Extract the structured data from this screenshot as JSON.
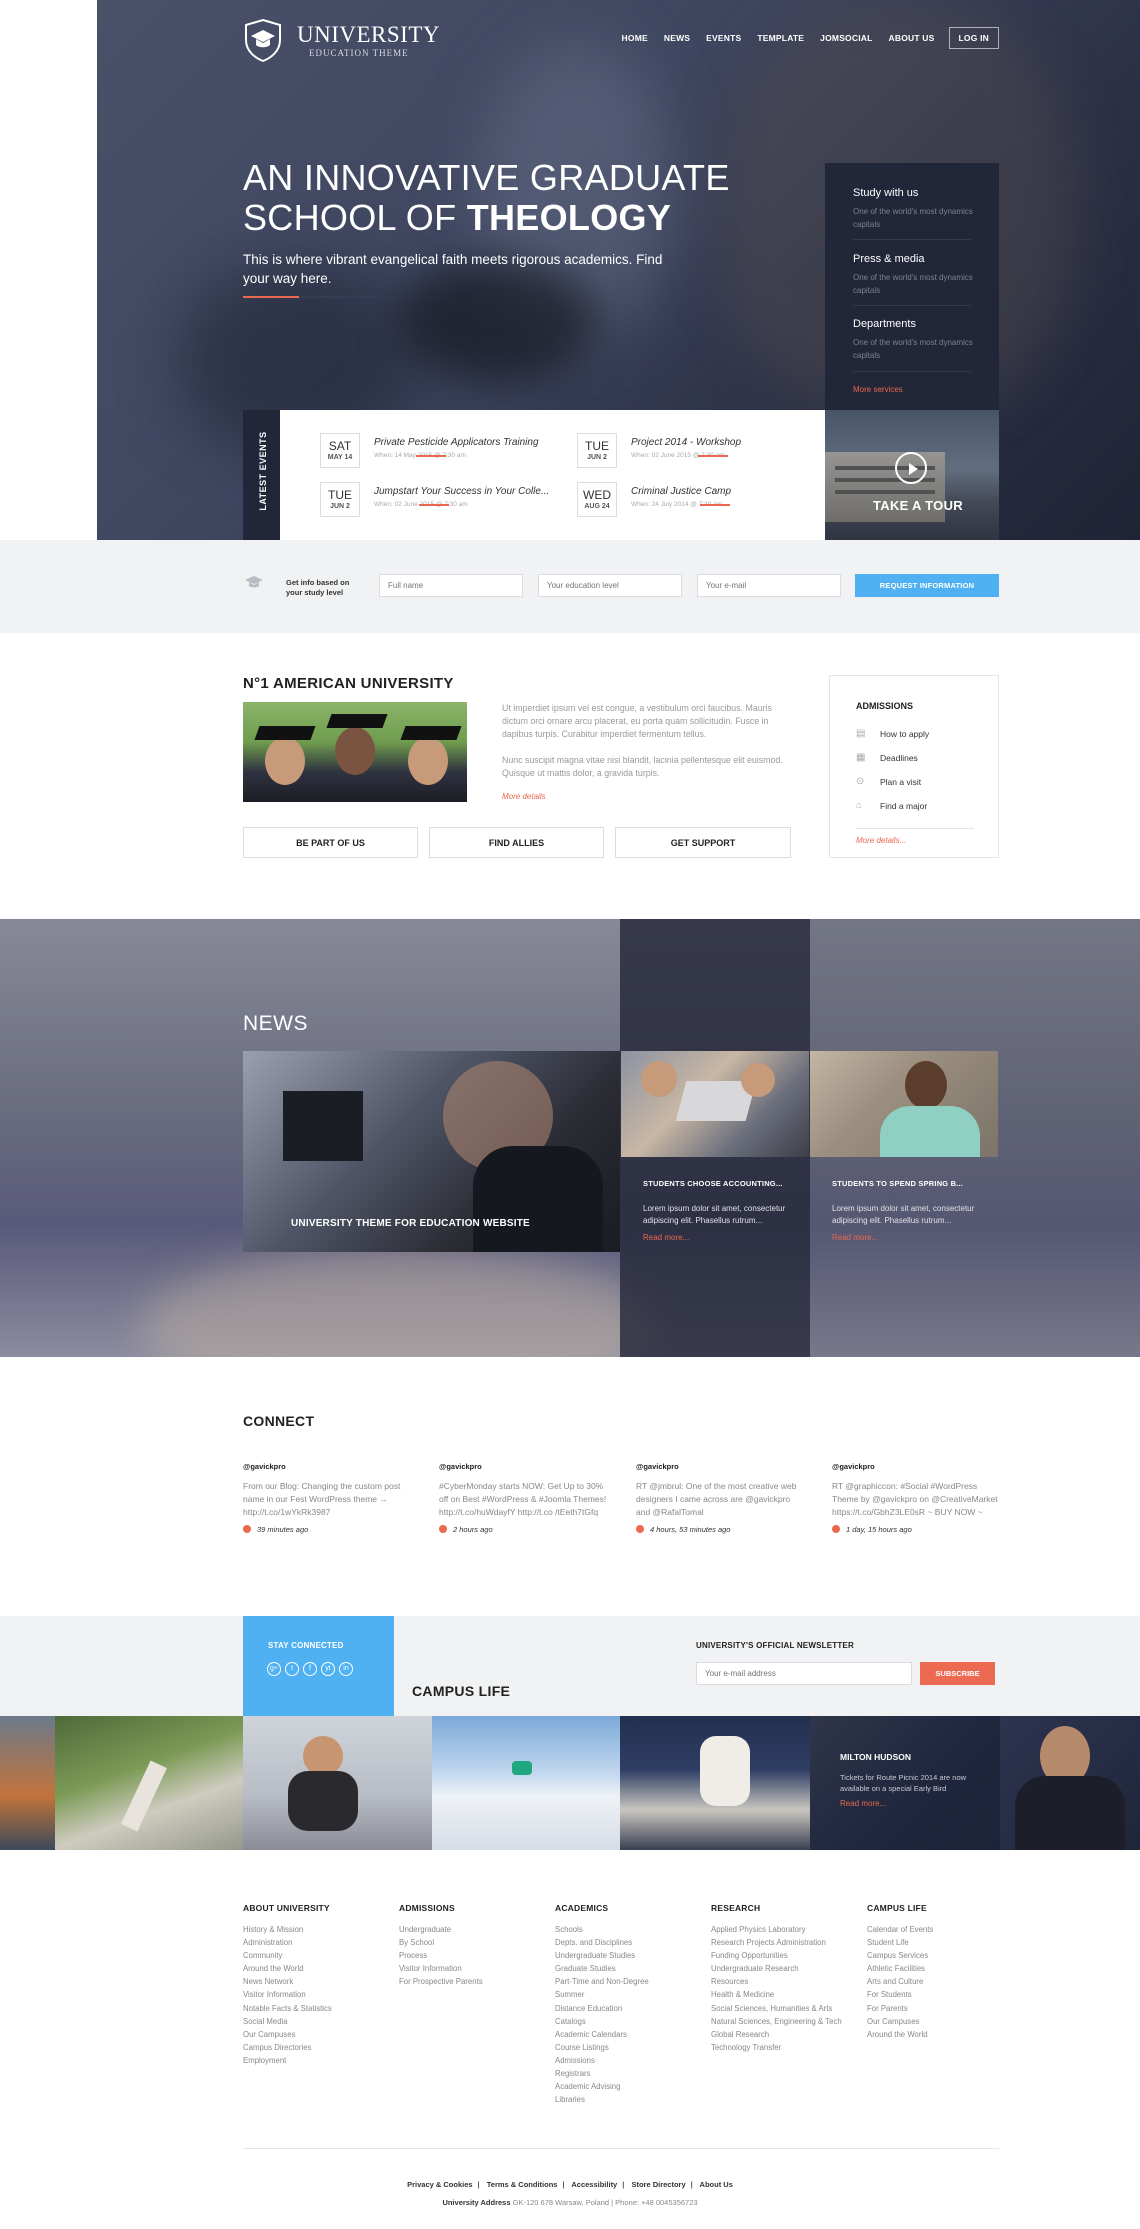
{
  "brand": {
    "name": "UNIVERSITY",
    "tagline": "EDUCATION THEME"
  },
  "nav": {
    "items": [
      "HOME",
      "NEWS",
      "EVENTS",
      "TEMPLATE",
      "JOMSOCIAL",
      "ABOUT US"
    ],
    "login": "LOG IN"
  },
  "hero": {
    "title_line1": "AN INNOVATIVE GRADUATE",
    "title_line2_plain": "SCHOOL OF",
    "title_line2_bold": "THEOLOGY",
    "subtitle": "This is where vibrant evangelical faith meets rigorous academics. Find your way here."
  },
  "side_panel": {
    "items": [
      {
        "title": "Study with us",
        "desc": "One of the world's most dynamics capitals"
      },
      {
        "title": "Press & media",
        "desc": "One of the world's most dynamics capitals"
      },
      {
        "title": "Departments",
        "desc": "One of the world's most dynamics capitals"
      }
    ],
    "more": "More services"
  },
  "events": {
    "label": "LATEST EVENTS",
    "items": [
      {
        "day": "SAT",
        "date": "MAY 14",
        "title": "Private Pesticide Applicators Training",
        "when": "When: 14 May 2015 @ 7:30 am"
      },
      {
        "day": "TUE",
        "date": "JUN 2",
        "title": "Project 2014 - Workshop",
        "when": "When: 02 June 2015 @ 7:30 am"
      },
      {
        "day": "TUE",
        "date": "JUN 2",
        "title": "Jumpstart Your Success in Your Colle...",
        "when": "When: 02 June 2015 @ 7:30 am"
      },
      {
        "day": "WED",
        "date": "AUG 24",
        "title": "Criminal Justice Camp",
        "when": "When: 24 July 2014 @ 7:30 am"
      }
    ],
    "tour": "TAKE A TOUR"
  },
  "request": {
    "label": "Get info based on your study level",
    "name_placeholder": "Full name",
    "level_placeholder": "Your education level",
    "email_placeholder": "Your e-mail",
    "button": "REQUEST INFORMATION"
  },
  "about": {
    "title": "N°1 AMERICAN UNIVERSITY",
    "p1": "Ut imperdiet ipsum vel est congue, a vestibulum orci faucibus. Mauris dictum orci ornare arcu placerat, eu porta quam sollicitudin. Fusce in dapibus turpis. Curabitur imperdiet fermentum tellus.",
    "p2": "Nunc suscipit magna vitae nisi blandit, lacinia pellentesque elit euismod. Quisque ut mattis dolor, a gravida turpis.",
    "more": "More details",
    "buttons": [
      "BE PART OF US",
      "FIND ALLIES",
      "GET SUPPORT"
    ]
  },
  "admissions": {
    "title": "ADMISSIONS",
    "items": [
      "How to apply",
      "Deadlines",
      "Plan a visit",
      "Find a major"
    ],
    "more": "More details..."
  },
  "news": {
    "title": "NEWS",
    "main_caption": "UNIVERSITY THEME FOR EDUCATION WEBSITE",
    "items": [
      {
        "title": "STUDENTS CHOOSE ACCOUNTING...",
        "text": "Lorem ipsum dolor sit amet, consectetur adipiscing elit. Phasellus rutrum...",
        "more": "Read more..."
      },
      {
        "title": "STUDENTS TO SPEND SPRING B...",
        "text": "Lorem ipsum dolor sit amet, consectetur adipiscing elit. Phasellus rutrum...",
        "more": "Read more..."
      }
    ]
  },
  "connect": {
    "title": "CONNECT",
    "tweets": [
      {
        "handle": "@gavickpro",
        "text": "From our Blog: Changing the custom post name in our Fest WordPress theme → http://t.co/1wYkRk3987",
        "time": "39 minutes ago"
      },
      {
        "handle": "@gavickpro",
        "text": "#CyberMonday starts NOW: Get Up to 30% off on Best #WordPress & #Joomla Themes! http://t.co/huWdayfY http://t.co /tEeth7tGfq",
        "time": "2 hours ago"
      },
      {
        "handle": "@gavickpro",
        "text": "RT @jmbrul: One of the most creative web designers I came across are @gavickpro and @RafalTomal",
        "time": "4 hours, 53 minutes ago"
      },
      {
        "handle": "@gavickpro",
        "text": "RT @graphiccon: #Social #WordPress Theme by @gavickpro on @CreativeMarket https://t.co/GbhZ3LE0sR ~ BUY NOW ~",
        "time": "1 day, 15 hours ago"
      }
    ]
  },
  "stay": {
    "title": "STAY CONNECTED",
    "icons": [
      "g+",
      "t",
      "f",
      "yt",
      "in"
    ]
  },
  "campus": {
    "title": "CAMPUS LIFE"
  },
  "newsletter": {
    "title": "UNIVERSITY'S OFFICIAL NEWSLETTER",
    "placeholder": "Your e-mail address",
    "button": "SUBSCRIBE"
  },
  "milton": {
    "title": "MILTON HUDSON",
    "text": "Tickets for Route Picnic 2014 are now available on a special Early Bird",
    "more": "Read more..."
  },
  "footer": {
    "columns": [
      {
        "title": "ABOUT UNIVERSITY",
        "links": [
          "History & Mission",
          "Administration",
          "Community",
          "Around the World",
          "News Network",
          "Visitor Information",
          "Notable Facts & Statistics",
          "Social Media",
          "Our Campuses",
          "Campus Directories",
          "Employment"
        ]
      },
      {
        "title": "ADMISSIONS",
        "links": [
          "Undergraduate",
          "By School",
          "Process",
          "Visitor Information",
          "For Prospective Parents"
        ]
      },
      {
        "title": "ACADEMICS",
        "links": [
          "Schools",
          "Depts. and Disciplines",
          "Undergraduate Studies",
          "Graduate Studies",
          "Part-Time and Non-Degree",
          "Summer",
          "Distance Education",
          "Catalogs",
          "Academic Calendars",
          "Course Listings",
          "Admissions",
          "Registrars",
          "Academic Advising",
          "Libraries"
        ]
      },
      {
        "title": "RESEARCH",
        "links": [
          "Applied Physics Laboratory",
          "Research Projects Administration",
          "Funding Opportunities",
          "Undergraduate Research",
          "Resources",
          "Health & Medicine",
          "Social Sciences, Humanities & Arts",
          "Natural Sciences, Engineering & Tech",
          "Global Research",
          "Technology Transfer"
        ]
      },
      {
        "title": "CAMPUS LIFE",
        "links": [
          "Calendar of Events",
          "Student Life",
          "Campus Services",
          "Athletic Facilities",
          "Arts and Culture",
          "For Students",
          "For Parents",
          "Our Campuses",
          "Around the World"
        ]
      }
    ],
    "links": [
      "Privacy & Cookies",
      "Terms & Conditions",
      "Accessibility",
      "Store Directory",
      "About Us"
    ],
    "address_label": "University Address",
    "address": "GK-120 678 Warsaw, Poland | Phone: +48 0045356723"
  }
}
